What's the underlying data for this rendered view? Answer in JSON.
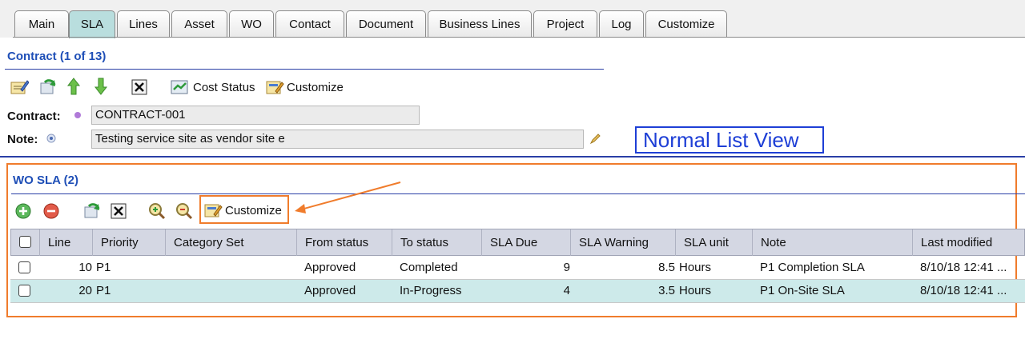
{
  "tabs": [
    {
      "label": "Main",
      "active": false
    },
    {
      "label": "SLA",
      "active": true
    },
    {
      "label": "Lines",
      "active": false
    },
    {
      "label": "Asset",
      "active": false
    },
    {
      "label": "WO",
      "active": false
    },
    {
      "label": "Contact",
      "active": false
    },
    {
      "label": "Document",
      "active": false
    },
    {
      "label": "Business Lines",
      "active": false
    },
    {
      "label": "Project",
      "active": false
    },
    {
      "label": "Log",
      "active": false
    },
    {
      "label": "Customize",
      "active": false
    }
  ],
  "contract_section": {
    "title": "Contract (1 of 13)",
    "toolbar": {
      "edit_icon": "edit-icon",
      "refresh_icon": "refresh-icon",
      "up_icon": "arrow-up-icon",
      "down_icon": "arrow-down-icon",
      "close_icon": "close-icon",
      "cost_status_label": "Cost Status",
      "customize_label": "Customize"
    },
    "contract_label": "Contract:",
    "contract_value": "CONTRACT-001",
    "note_label": "Note:",
    "note_value": "Testing service site as vendor site e"
  },
  "callout_text": "Normal List View",
  "wo_sla": {
    "title": "WO SLA (2)",
    "toolbar": {
      "add_icon": "add-icon",
      "remove_icon": "remove-icon",
      "refresh_icon": "refresh-icon",
      "close_icon": "close-icon",
      "zoom_in_icon": "zoom-in-icon",
      "zoom_out_icon": "zoom-out-icon",
      "customize_label": "Customize"
    },
    "columns": [
      "Line",
      "Priority",
      "Category Set",
      "From status",
      "To status",
      "SLA Due",
      "SLA Warning",
      "SLA unit",
      "Note",
      "Last modified"
    ],
    "rows": [
      {
        "line": "10",
        "priority": "P1",
        "category_set": "",
        "from_status": "Approved",
        "to_status": "Completed",
        "sla_due": "9",
        "sla_warning": "8.5",
        "sla_unit": "Hours",
        "note": "P1 Completion SLA",
        "last_modified": "8/10/18 12:41 ..."
      },
      {
        "line": "20",
        "priority": "P1",
        "category_set": "",
        "from_status": "Approved",
        "to_status": "In-Progress",
        "sla_due": "4",
        "sla_warning": "3.5",
        "sla_unit": "Hours",
        "note": "P1 On-Site SLA",
        "last_modified": "8/10/18 12:41 ..."
      }
    ]
  },
  "colors": {
    "accent_blue": "#1f4fb7",
    "active_tab": "#b9dede",
    "highlight_row": "#cdeaea",
    "annotation_orange": "#f07c2c",
    "callout_blue": "#1e3fd6"
  }
}
